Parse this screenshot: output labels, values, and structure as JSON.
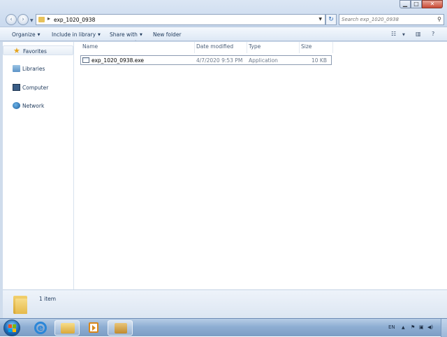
{
  "window": {
    "address_path": "exp_1020_0938",
    "search_placeholder": "Search exp_1020_0938",
    "controls": {
      "minimize": "▁",
      "maximize": "□",
      "close": "✕"
    }
  },
  "toolbar": {
    "organize": "Organize",
    "include_in_library": "Include in library",
    "share_with": "Share with",
    "new_folder": "New folder"
  },
  "nav": {
    "favorites": "Favorites",
    "libraries": "Libraries",
    "computer": "Computer",
    "network": "Network"
  },
  "columns": {
    "name": "Name",
    "date_modified": "Date modified",
    "type": "Type",
    "size": "Size"
  },
  "files": [
    {
      "name": "exp_1020_0938.exe",
      "date_modified": "4/7/2020 9:53 PM",
      "type": "Application",
      "size": "10 KB"
    }
  ],
  "details": {
    "item_count": "1 item"
  },
  "taskbar": {
    "pinned": [
      "start-orb-icon",
      "internet-explorer-icon",
      "windows-explorer-icon",
      "media-player-icon",
      "package-icon"
    ],
    "tray": {
      "language": "EN"
    }
  },
  "colors": {
    "window_frame": "#cfdcec",
    "text": "#1e395b",
    "taskbar": "#8eaed3",
    "close_button": "#c94a35"
  }
}
